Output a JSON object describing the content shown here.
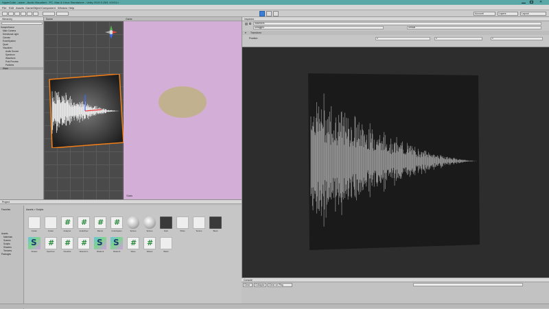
{
  "window": {
    "title": "HyperCube - wave - Audio Visualizer - PC, Mac & Linux Standalone - Unity 2019.3.15f1 <DX11>"
  },
  "menu": [
    "File",
    "Edit",
    "Assets",
    "GameObject",
    "Component",
    "Window",
    "Help"
  ],
  "toolbar": {
    "account_label": "Account",
    "layers_label": "Layers",
    "layout_label": "Layout"
  },
  "hierarchy": {
    "tab": "Hierarchy",
    "rows": [
      "SampleScene",
      "Main Camera",
      "Directional Light",
      "Canvas",
      "EventSystem",
      "Quad",
      "Visualizer",
      "Audio Source",
      "Spectrum",
      "Waveform",
      "Post Process",
      "Particles",
      "Wave"
    ]
  },
  "scene": {
    "tab": "Scene"
  },
  "game": {
    "tab": "Game",
    "stats": "Stats"
  },
  "inspector": {
    "tab": "Inspector",
    "object_name": "Waveform",
    "tag": "Untagged",
    "layer": "Default",
    "transform": "Transform",
    "position_label": "Position",
    "fields": [
      "0",
      "0",
      "0"
    ]
  },
  "project": {
    "tab": "Project",
    "breadcrumb": "Assets > Scripts",
    "tree": [
      "Favorites",
      "Assets",
      "Materials",
      "Scenes",
      "Scripts",
      "Shaders",
      "Textures",
      "Packages"
    ],
    "assets": [
      {
        "name": "Folder",
        "kind": "white"
      },
      {
        "name": "Folder",
        "kind": "white"
      },
      {
        "name": "Analyzer",
        "kind": "script"
      },
      {
        "name": "AudioPeer",
        "kind": "script"
      },
      {
        "name": "Bands",
        "kind": "script"
      },
      {
        "name": "CubeSpawn",
        "kind": "script"
      },
      {
        "name": "Sphere",
        "kind": "sphere"
      },
      {
        "name": "Sphere",
        "kind": "sphere"
      },
      {
        "name": "Dark",
        "kind": "dark"
      },
      {
        "name": "White",
        "kind": "white"
      },
      {
        "name": "Texture",
        "kind": "white"
      },
      {
        "name": "Black",
        "kind": "dark"
      },
      {
        "name": "Shader",
        "kind": "shader"
      },
      {
        "name": "Spectrum",
        "kind": "script"
      },
      {
        "name": "Visualize",
        "kind": "script"
      },
      {
        "name": "Waveform",
        "kind": "script"
      },
      {
        "name": "Shader2",
        "kind": "shader"
      },
      {
        "name": "Shader3",
        "kind": "shader"
      },
      {
        "name": "Wave",
        "kind": "script"
      },
      {
        "name": "Wave2",
        "kind": "script"
      },
      {
        "name": "Blank",
        "kind": "white"
      }
    ]
  },
  "console": {
    "tab": "Console",
    "buttons": [
      "Clear",
      "Collapse",
      "Clear on Play"
    ]
  },
  "icons": {
    "script": "#",
    "shader": "S"
  }
}
